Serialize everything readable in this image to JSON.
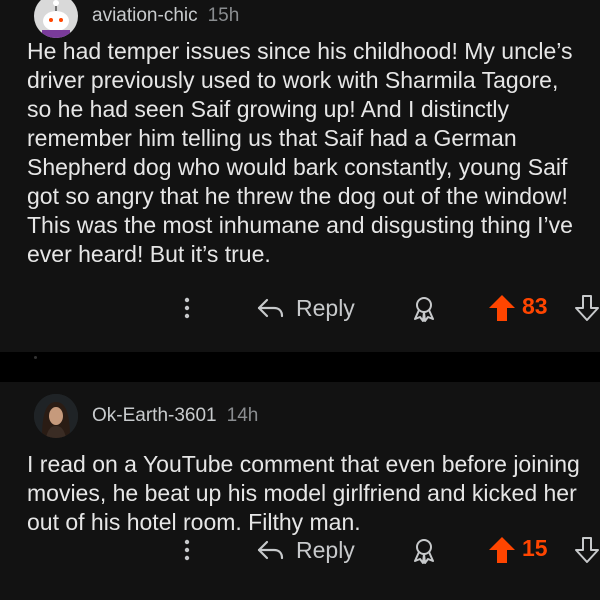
{
  "comments": [
    {
      "username": "aviation-chic",
      "time": "15h",
      "body": "He had temper issues since his childhood! My uncle’s driver previously used to work with Sharmila Tagore, so he had seen Saif growing up! And I distinctly remember him telling us that Saif had a German Shepherd dog who would bark constantly, young Saif got so angry that he threw the dog out of the window! This was the most inhumane and disgusting thing I’ve ever heard! But it’s true.",
      "reply_label": "Reply",
      "votes": "83"
    },
    {
      "username": "Ok-Earth-3601",
      "time": "14h",
      "body": "I read on a YouTube comment that even before joining movies, he beat up his model girlfriend and kicked her out of his hotel room. Filthy man.",
      "reply_label": "Reply",
      "votes": "15"
    }
  ],
  "icons": {
    "more": "more-vertical-icon",
    "reply": "reply-arrow-icon",
    "award": "award-icon",
    "upvote": "upvote-arrow-icon",
    "downvote": "downvote-arrow-icon"
  },
  "colors": {
    "background": "#000000",
    "comment_bg": "#121212",
    "upvote_active": "#ff4500",
    "text": "#e6e6e6",
    "meta": "#8a8d90"
  }
}
